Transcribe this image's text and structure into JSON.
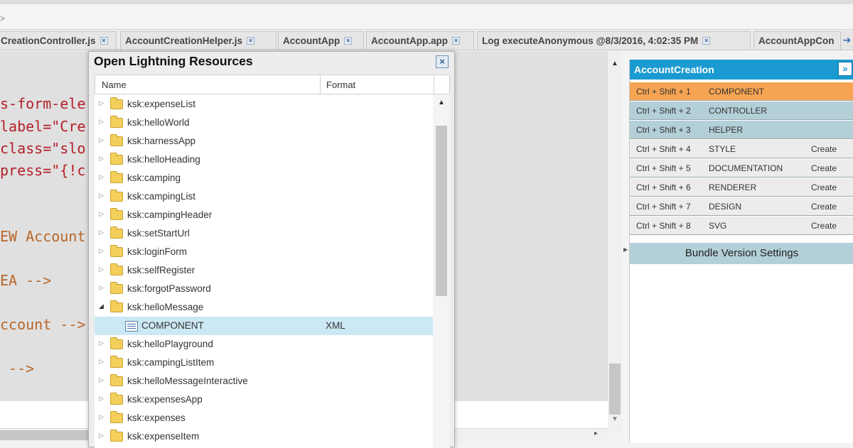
{
  "breadcrumb": {
    "arrow": ">"
  },
  "tabs": [
    {
      "label": "CreationController.js"
    },
    {
      "label": "AccountCreationHelper.js"
    },
    {
      "label": "AccountApp"
    },
    {
      "label": "AccountApp.app"
    },
    {
      "label": "Log executeAnonymous @8/3/2016, 4:02:35 PM"
    },
    {
      "label": "AccountAppCon"
    }
  ],
  "tab_close_glyph": "×",
  "editor": {
    "lines": [
      "s-form-ele",
      "label=\"Cre",
      "class=\"slo",
      "press=\"{!c",
      "EW Account",
      "EA -->",
      "ccount -->",
      " -->"
    ]
  },
  "dialog": {
    "title": "Open Lightning Resources",
    "close_glyph": "×",
    "columns": {
      "name": "Name",
      "format": "Format"
    },
    "rows": [
      {
        "label": "ksk:expenseList",
        "expanded": false
      },
      {
        "label": "ksk:helloWorld",
        "expanded": false
      },
      {
        "label": "ksk:harnessApp",
        "expanded": false
      },
      {
        "label": "ksk:helloHeading",
        "expanded": false
      },
      {
        "label": "ksk:camping",
        "expanded": false
      },
      {
        "label": "ksk:campingList",
        "expanded": false
      },
      {
        "label": "ksk:campingHeader",
        "expanded": false
      },
      {
        "label": "ksk:setStartUrl",
        "expanded": false
      },
      {
        "label": "ksk:loginForm",
        "expanded": false
      },
      {
        "label": "ksk:selfRegister",
        "expanded": false
      },
      {
        "label": "ksk:forgotPassword",
        "expanded": false
      },
      {
        "label": "ksk:helloMessage",
        "expanded": true
      },
      {
        "label": "COMPONENT",
        "format": "XML",
        "child": true,
        "selected": true
      },
      {
        "label": "ksk:helloPlayground",
        "expanded": false
      },
      {
        "label": "ksk:campingListItem",
        "expanded": false
      },
      {
        "label": "ksk:helloMessageInteractive",
        "expanded": false
      },
      {
        "label": "ksk:expensesApp",
        "expanded": false
      },
      {
        "label": "ksk:expenses",
        "expanded": false
      },
      {
        "label": "ksk:expenseItem",
        "expanded": false
      }
    ]
  },
  "bundle": {
    "title": "AccountCreation",
    "expand_glyph": "»",
    "rows": [
      {
        "shortcut": "Ctrl + Shift + 1",
        "name": "COMPONENT",
        "action": "",
        "state": "active"
      },
      {
        "shortcut": "Ctrl + Shift + 2",
        "name": "CONTROLLER",
        "action": "",
        "state": "exists"
      },
      {
        "shortcut": "Ctrl + Shift + 3",
        "name": "HELPER",
        "action": "",
        "state": "exists"
      },
      {
        "shortcut": "Ctrl + Shift + 4",
        "name": "STYLE",
        "action": "Create",
        "state": "empty"
      },
      {
        "shortcut": "Ctrl + Shift + 5",
        "name": "DOCUMENTATION",
        "action": "Create",
        "state": "empty"
      },
      {
        "shortcut": "Ctrl + Shift + 6",
        "name": "RENDERER",
        "action": "Create",
        "state": "empty"
      },
      {
        "shortcut": "Ctrl + Shift + 7",
        "name": "DESIGN",
        "action": "Create",
        "state": "empty"
      },
      {
        "shortcut": "Ctrl + Shift + 8",
        "name": "SVG",
        "action": "Create",
        "state": "empty"
      }
    ],
    "settings_label": "Bundle Version Settings"
  },
  "colors": {
    "accent": "#1a9ad0",
    "active_row": "#f6a453",
    "exists_row": "#b3cfd8",
    "selection": "#cce8f4"
  }
}
